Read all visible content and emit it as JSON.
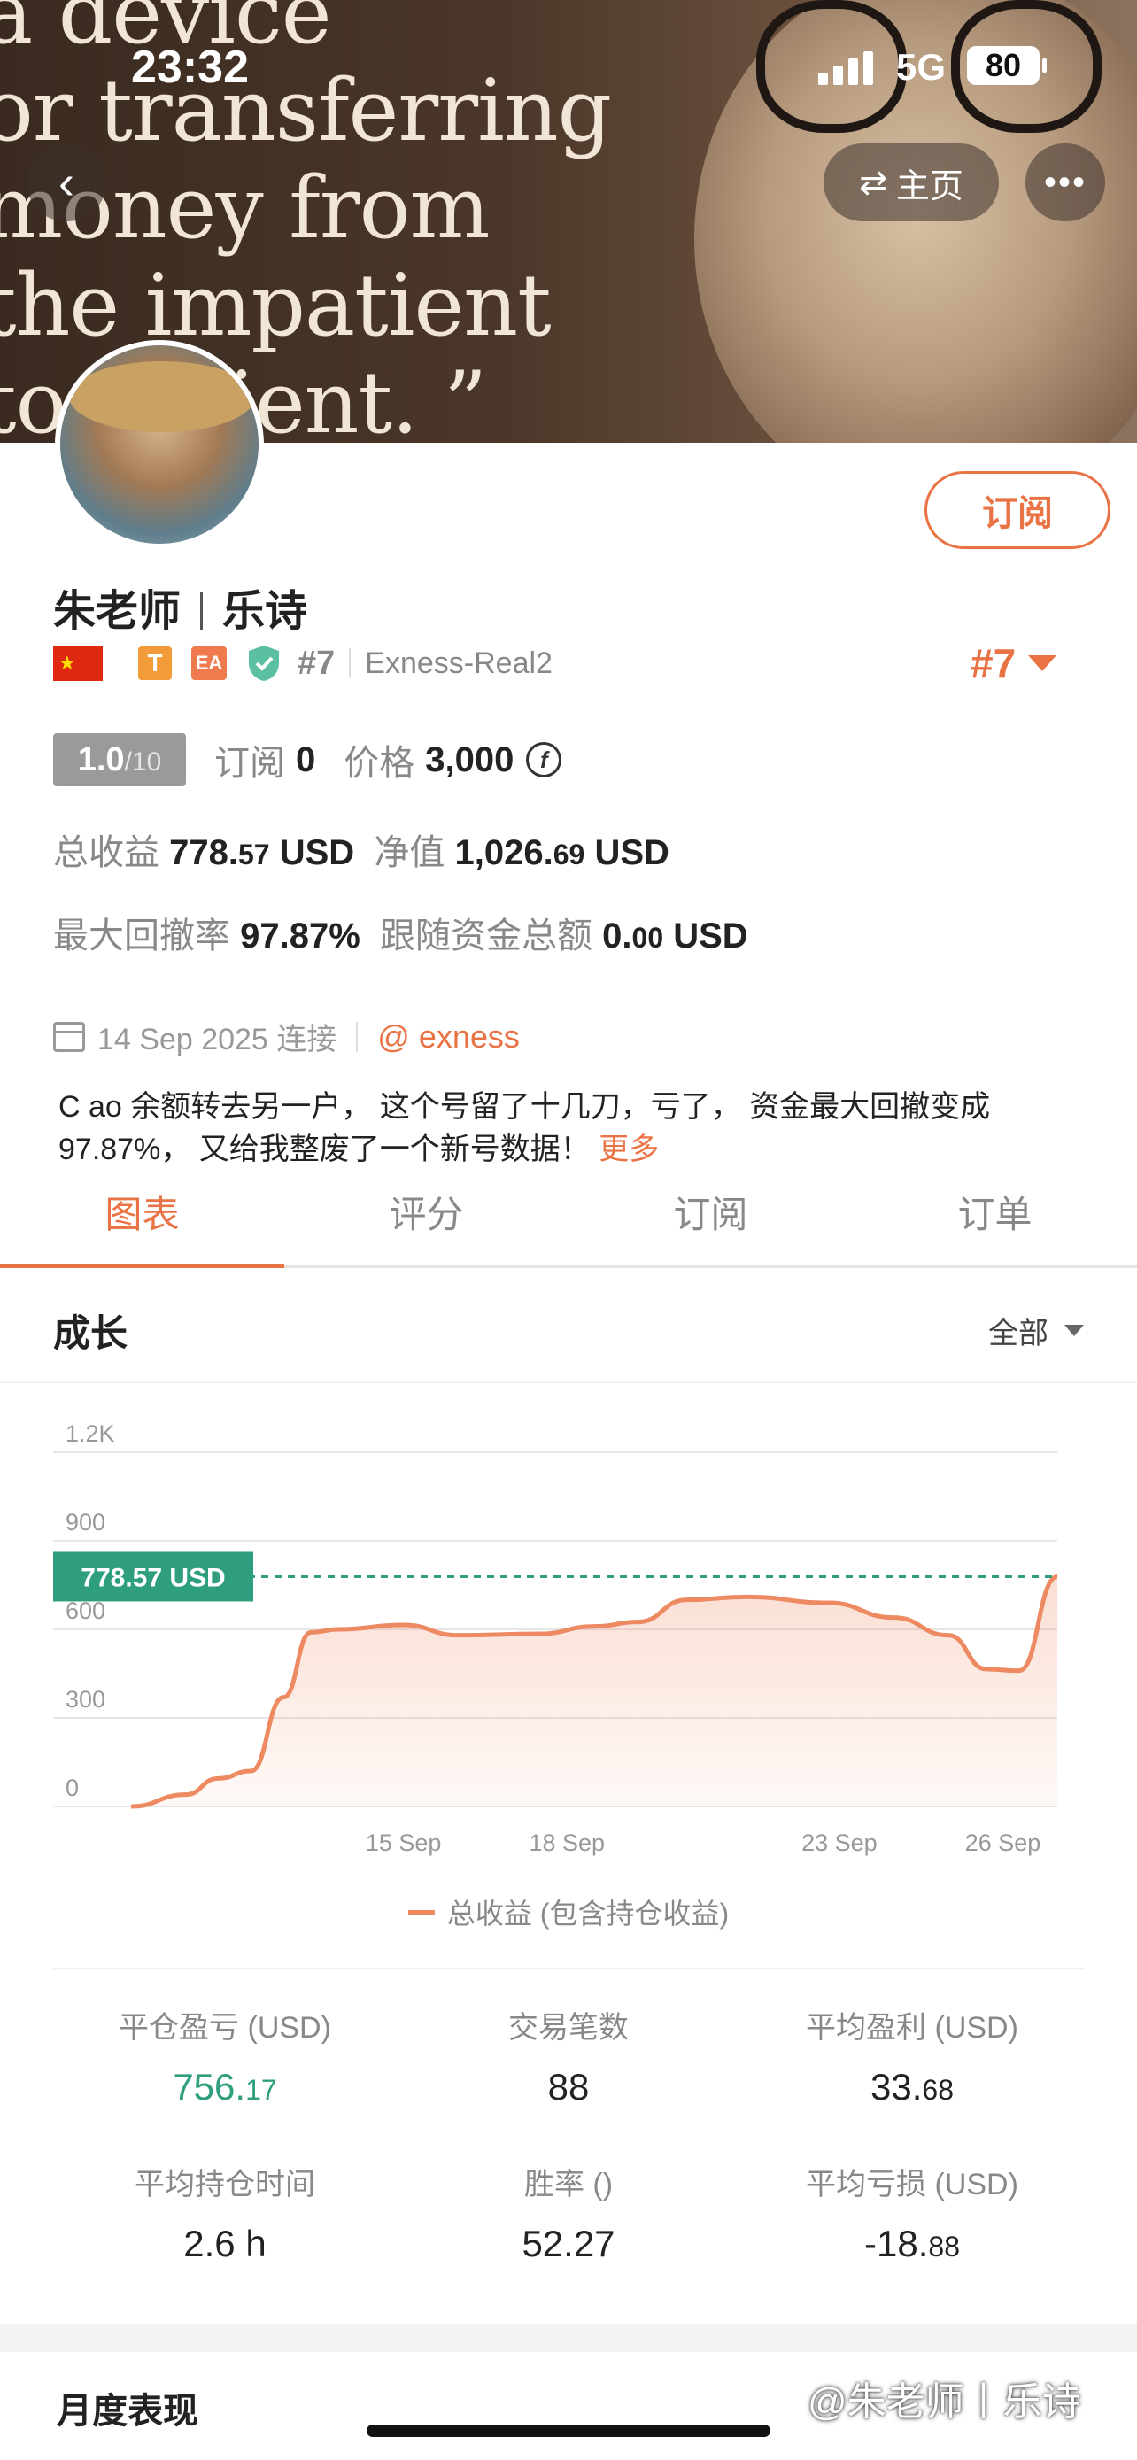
{
  "status_bar": {
    "time": "23:32",
    "network": "5G",
    "battery": "80"
  },
  "banner": {
    "quote_lines": [
      "a device",
      "or transferring",
      "money from",
      "the impatient",
      "to   patient. ”"
    ]
  },
  "nav": {
    "back_icon": "‹",
    "home_icon": "⇄",
    "home_label": "主页",
    "more_icon": "•••"
  },
  "profile": {
    "subscribe_label": "订阅",
    "name_left": "朱老师",
    "name_right": "乐诗",
    "badge_t": "T",
    "badge_ea": "EA",
    "rank": "#7",
    "server": "Exness-Real2",
    "rank_right": "#7",
    "score": "1.0",
    "score_max": "/10",
    "subs_label": "订阅",
    "subs_value": "0",
    "price_label": "价格",
    "price_value": "3,000",
    "coin_icon": "f",
    "total_profit_label": "总收益",
    "total_profit_int": "778.",
    "total_profit_dec": "57",
    "total_profit_cur": " USD",
    "equity_label": "净值",
    "equity_int": "1,026.",
    "equity_dec": "69",
    "equity_cur": " USD",
    "max_dd_label": "最大回撤率",
    "max_dd_value": "97.87%",
    "follow_label": "跟随资金总额",
    "follow_int": "0.",
    "follow_dec": "00",
    "follow_cur": " USD",
    "connect_date": "14 Sep 2025 连接",
    "broker": "@ exness",
    "description": "C ao 余额转去另一户，  这个号留了十几刀，亏了，  资金最大回撤变成97.87%，  又给我整废了一个新号数据！",
    "more_label": "更多"
  },
  "tabs": [
    "图表",
    "评分",
    "订阅",
    "订单"
  ],
  "growth": {
    "title": "成长",
    "range": "全部",
    "legend": "总收益 (包含持仓收益)",
    "current_label": "778.57 USD"
  },
  "chart_data": {
    "type": "area",
    "title": "成长",
    "xlabel": "",
    "ylabel": "",
    "ylim": [
      0,
      1200
    ],
    "yticks": [
      0,
      300,
      600,
      900,
      1200
    ],
    "ytick_labels": [
      "0",
      "300",
      "600",
      "900",
      "1.2K"
    ],
    "xtick_labels": [
      "15 Sep",
      "18 Sep",
      "23 Sep",
      "26 Sep"
    ],
    "xtick_positions": [
      5,
      8,
      13,
      16
    ],
    "x": [
      0,
      1,
      1.6,
      2.2,
      2.8,
      3.3,
      3.8,
      5,
      6,
      7.5,
      8.5,
      9.3,
      10.2,
      11.3,
      12.8,
      14.0,
      15.0,
      15.7,
      16.3,
      17.0
    ],
    "y": [
      0,
      40,
      95,
      120,
      370,
      590,
      600,
      615,
      580,
      585,
      610,
      625,
      700,
      710,
      690,
      640,
      580,
      465,
      460,
      778.57
    ],
    "series": [
      {
        "name": "总收益 (包含持仓收益)",
        "color": "#ee8a62"
      }
    ],
    "reference_line": {
      "value": 778.57,
      "label": "778.57 USD",
      "color": "#2e9e7f"
    },
    "grid": true
  },
  "stats": [
    {
      "label": "平仓盈亏 (USD)",
      "int": "756.",
      "dec": "17",
      "color": "green"
    },
    {
      "label": "交易笔数",
      "int": "88",
      "dec": ""
    },
    {
      "label": "平均盈利 (USD)",
      "int": "33.",
      "dec": "68"
    },
    {
      "label": "平均持仓时间",
      "int": "2.6 h",
      "dec": ""
    },
    {
      "label": "胜率 ()",
      "int": "52.27",
      "dec": ""
    },
    {
      "label": "平均亏损 (USD)",
      "int": "-18.",
      "dec": "88"
    }
  ],
  "monthly_title": "月度表现",
  "watermark": "@朱老师丨乐诗",
  "colors": {
    "accent": "#ea7345",
    "green": "#2e9e7f",
    "line": "#ee8a62"
  }
}
